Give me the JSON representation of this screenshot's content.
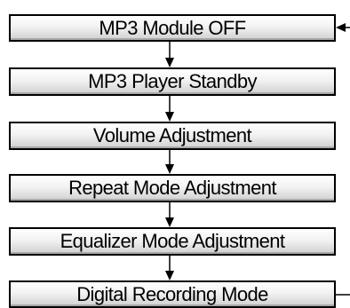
{
  "flow": {
    "steps": [
      {
        "label": "MP3 Module OFF"
      },
      {
        "label": "MP3 Player Standby"
      },
      {
        "label": "Volume Adjustment"
      },
      {
        "label": "Repeat Mode Adjustment"
      },
      {
        "label": "Equalizer Mode Adjustment"
      },
      {
        "label": "Digital Recording Mode"
      }
    ]
  },
  "colors": {
    "box_border": "#000000",
    "box_fill_top": "#ffffff",
    "box_fill_bottom": "#cfcfcf",
    "connector": "#000000"
  }
}
